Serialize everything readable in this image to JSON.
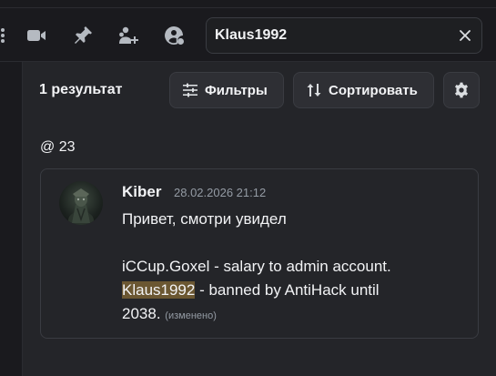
{
  "search": {
    "value": "Klaus1992"
  },
  "results": {
    "count_label": "1 результат",
    "filters_label": "Фильтры",
    "sort_label": "Сортировать"
  },
  "channel": {
    "label": "@ 23"
  },
  "message": {
    "author": "Kiber",
    "timestamp": "28.02.2026 21:12",
    "line1": "Привет, смотри увидел",
    "line2": "iCCup.Goxel - salary to admin account.",
    "highlight": "Klaus1992",
    "line3_rest": " - banned by AntiHack until",
    "line4": "2038.",
    "edited": "(изменено)"
  },
  "colors": {
    "background": "#1a1a1e",
    "panel": "#242529",
    "highlight": "#6b5732",
    "muted_text": "#949ba4"
  },
  "icons": [
    "video-camera-icon",
    "pin-icon",
    "add-member-icon",
    "member-list-icon",
    "close-icon",
    "filters-icon",
    "sort-icon",
    "settings-gear-icon"
  ]
}
